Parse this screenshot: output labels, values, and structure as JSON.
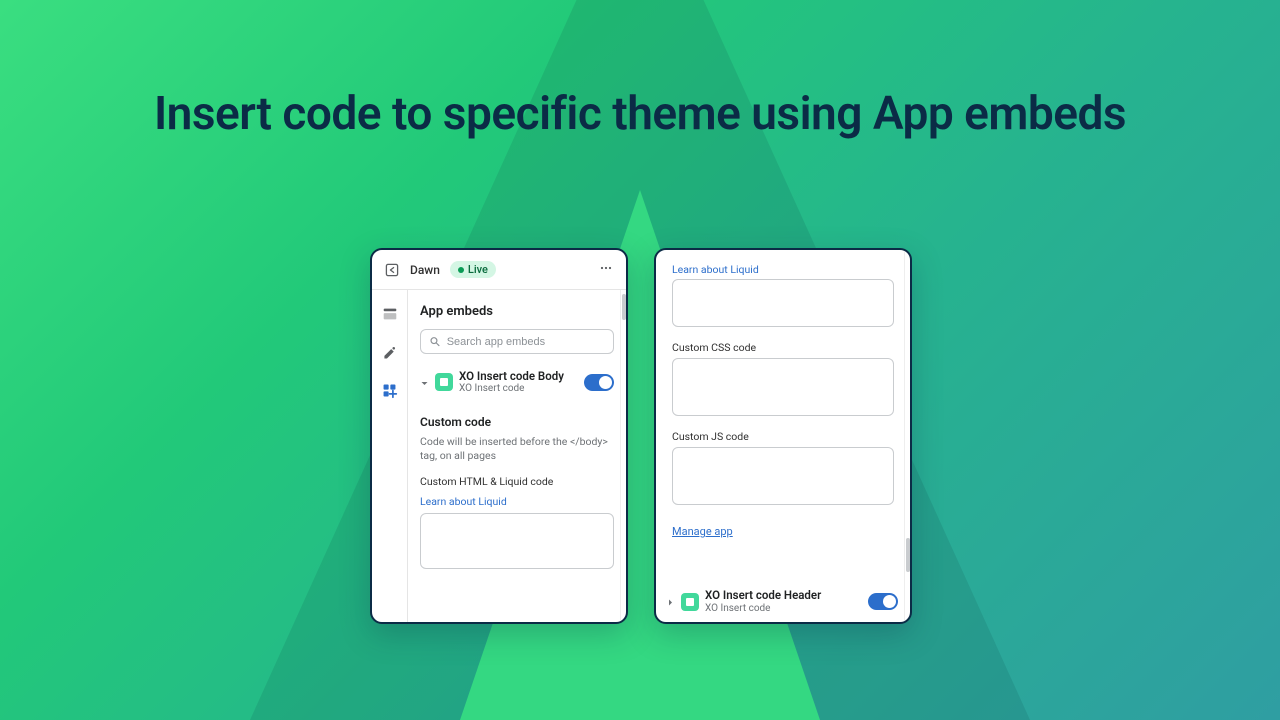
{
  "headline": "Insert code to specific theme using App embeds",
  "left": {
    "theme_name": "Dawn",
    "live_label": "Live",
    "section_title": "App embeds",
    "search_placeholder": "Search app embeds",
    "embed": {
      "title": "XO Insert code Body",
      "subtitle": "XO Insert code"
    },
    "custom_code_heading": "Custom code",
    "custom_code_desc": "Code will be inserted before the </body> tag, on all pages",
    "html_label": "Custom HTML & Liquid code",
    "learn_liquid": "Learn about Liquid"
  },
  "right": {
    "learn_liquid": "Learn about Liquid",
    "css_label": "Custom CSS code",
    "js_label": "Custom JS code",
    "manage_app": "Manage app",
    "embed": {
      "title": "XO Insert code Header",
      "subtitle": "XO Insert code"
    }
  }
}
